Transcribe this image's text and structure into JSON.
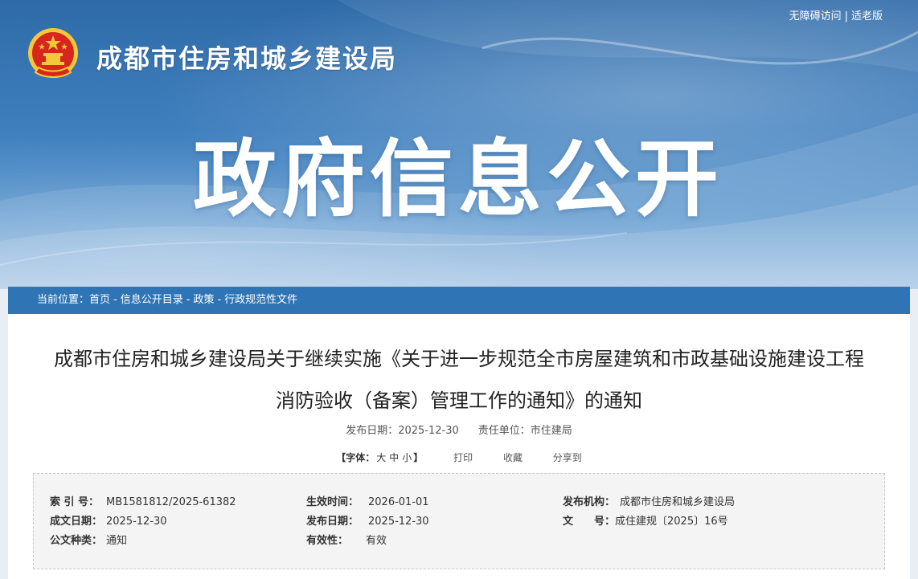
{
  "header": {
    "org_name": "成都市住房和城乡建设局",
    "accessibility_link": "无障碍访问",
    "separator": "|",
    "elderly_link": "适老版",
    "banner_title": "政府信息公开"
  },
  "breadcrumb": {
    "prefix": "当前位置：",
    "items": [
      "首页",
      "信息公开目录",
      "政策",
      "行政规范性文件"
    ],
    "separator": "-"
  },
  "article": {
    "title_line1": "成都市住房和城乡建设局关于继续实施《关于进一步规范全市房屋建筑和市政基础设施建设工程",
    "title_line2": "消防验收（备案）管理工作的通知》的通知",
    "publish_label": "发布日期：",
    "publish_date": "2025-12-30",
    "unit_label": "责任单位：",
    "unit_value": "市住建局"
  },
  "tools": {
    "font_label": "【字体：",
    "size_large": "大",
    "size_medium": "中",
    "size_small": "小",
    "font_close": "】",
    "print": "打印",
    "favorite": "收藏",
    "share": "分享到"
  },
  "info": {
    "index_no_label": "索 引 号：",
    "index_no": "MB1581812/2025-61382",
    "effective_time_label": "生效时间：",
    "effective_time": "2026-01-01",
    "issuer_label": "发布机构：",
    "issuer": "成都市住房和城乡建设局",
    "written_date_label": "成文日期：",
    "written_date": "2025-12-30",
    "publish_date_label": "发布日期：",
    "publish_date": "2025-12-30",
    "doc_no_label": "文　　号：",
    "doc_no": "成住建规〔2025〕16号",
    "doc_type_label": "公文种类：",
    "doc_type": "通知",
    "validity_label": "有效性：",
    "validity": "有效"
  },
  "colors": {
    "banner_blue": "#3f7fbe",
    "crumb_blue": "#2f74b5",
    "emblem_red": "#d7261e",
    "emblem_gold": "#f5c83a"
  },
  "icons": {
    "emblem": "national-emblem-icon"
  }
}
